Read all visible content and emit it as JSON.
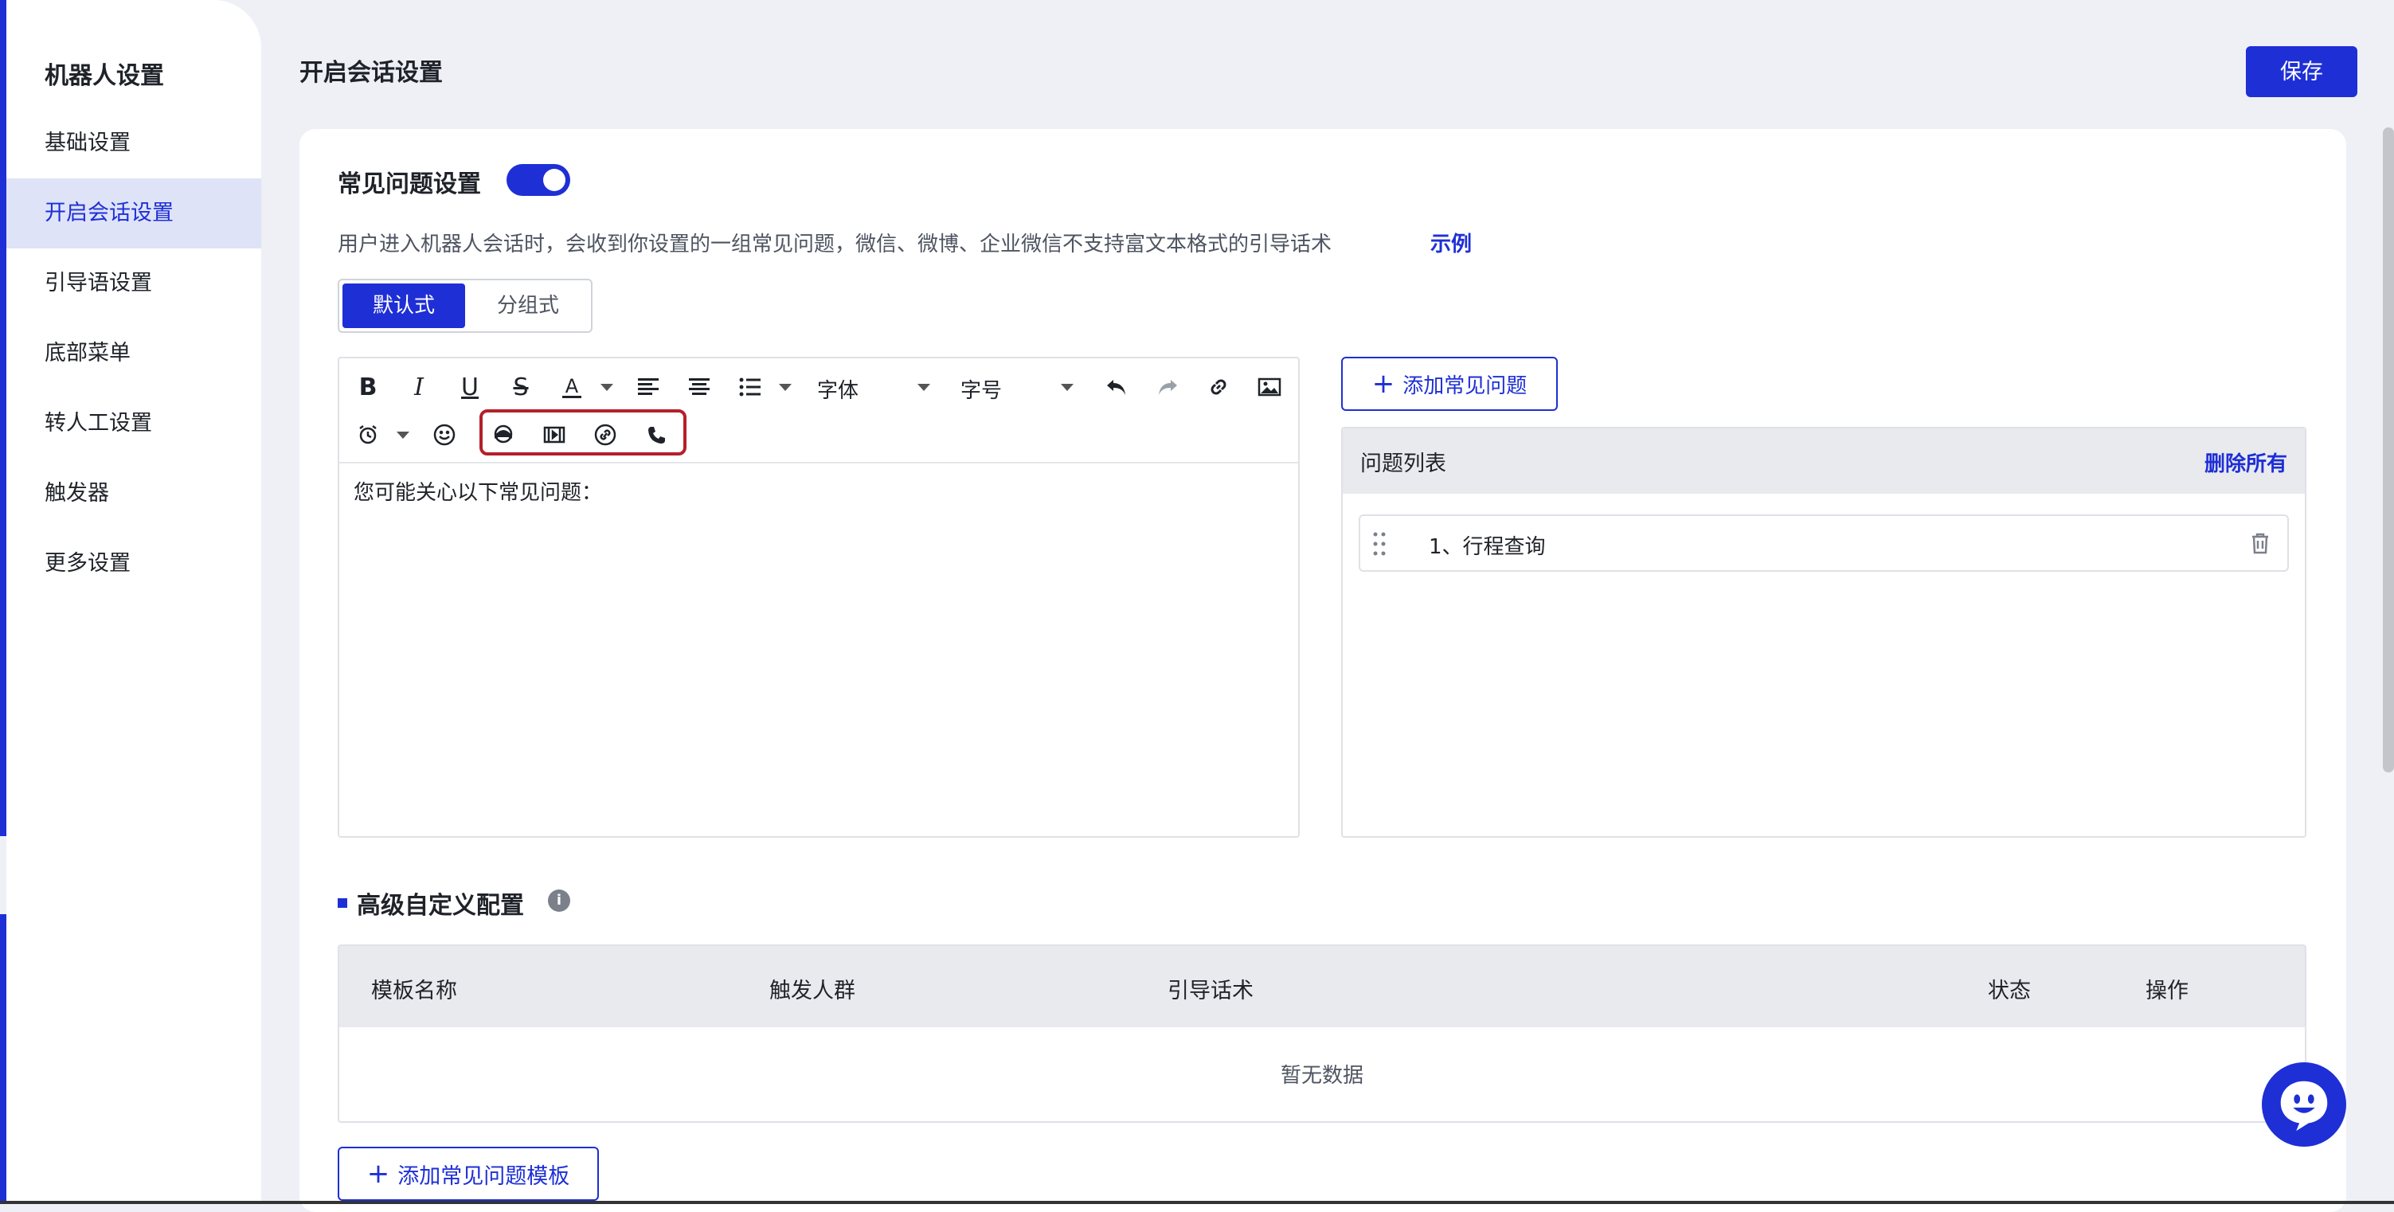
{
  "sidebar": {
    "title": "机器人设置",
    "items": [
      {
        "label": "基础设置"
      },
      {
        "label": "开启会话设置"
      },
      {
        "label": "引导语设置"
      },
      {
        "label": "底部菜单"
      },
      {
        "label": "转人工设置"
      },
      {
        "label": "触发器"
      },
      {
        "label": "更多设置"
      }
    ],
    "active_index": 1
  },
  "header": {
    "title": "开启会话设置",
    "save_label": "保存"
  },
  "faq": {
    "title": "常见问题设置",
    "enabled": true,
    "description": "用户进入机器人会话时，会收到你设置的一组常见问题，微信、微博、企业微信不支持富文本格式的引导话术",
    "example_link": "示例",
    "modes": [
      "默认式",
      "分组式"
    ],
    "active_mode": 0
  },
  "editor": {
    "font_select": "字体",
    "size_select": "字号",
    "content": "您可能关心以下常见问题："
  },
  "question_list": {
    "add_label": "添加常见问题",
    "header": "问题列表",
    "delete_all": "删除所有",
    "items": [
      {
        "text": "1、行程查询"
      }
    ]
  },
  "advanced": {
    "title": "高级自定义配置",
    "columns": [
      "模板名称",
      "触发人群",
      "引导话术",
      "状态",
      "操作"
    ],
    "empty_text": "暂无数据",
    "add_template_label": "添加常见问题模板"
  },
  "icons": {
    "toolbar": [
      "bold-icon",
      "italic-icon",
      "underline-icon",
      "strikethrough-icon",
      "font-color-icon",
      "align-left-icon",
      "align-center-icon",
      "list-icon",
      "undo-icon",
      "redo-icon",
      "link-icon",
      "image-icon",
      "alarm-icon",
      "emoji-icon",
      "customer-service-icon",
      "video-icon",
      "link-card-icon",
      "phone-icon"
    ]
  },
  "colors": {
    "accent": "#1e2fd6",
    "highlight_box": "#b3202a",
    "background": "#eef0f6"
  }
}
